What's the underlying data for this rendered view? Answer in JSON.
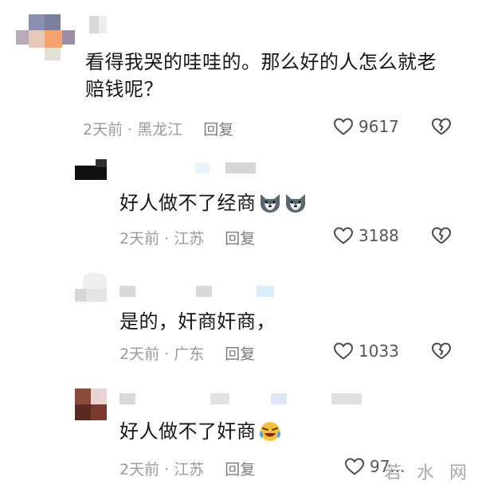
{
  "comments": [
    {
      "text": "看得我哭的哇哇的。那么好的人怎么就老赔钱呢？",
      "meta": "2天前 · 黑龙江",
      "reply": "回复",
      "likes": "9617"
    },
    {
      "text": "好人做不了经商",
      "meta": "2天前 · 江苏",
      "reply": "回复",
      "likes": "3188"
    },
    {
      "text": "是的，奸商奸商，",
      "meta": "2天前 · 广东",
      "reply": "回复",
      "likes": "1033"
    },
    {
      "text": "好人做不了奸商",
      "meta": "2天前 · 江苏",
      "reply": "回复",
      "likes": "97..."
    }
  ],
  "icons": {
    "like": "heart-outline-icon",
    "dislike": "broken-heart-icon",
    "emoji_2": "husky-dog-emoji-icon",
    "emoji_4": "laughing-crying-emoji-icon"
  },
  "watermark": "若 水 网"
}
